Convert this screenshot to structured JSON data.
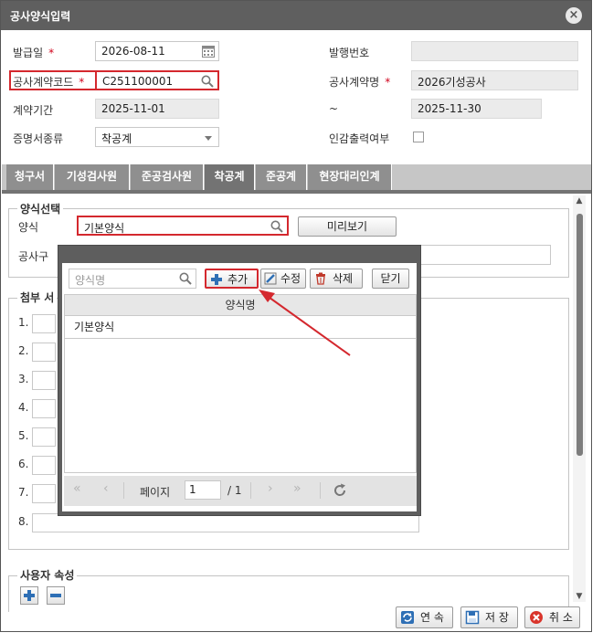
{
  "window": {
    "title": "공사양식입력"
  },
  "form": {
    "issue_date_label": "발급일",
    "issue_date_value": "2026-08-11",
    "issue_no_label": "발행번호",
    "contract_code_label": "공사계약코드",
    "contract_code_value": "C251100001",
    "contract_name_label": "공사계약명",
    "contract_name_value": "2026기성공사",
    "period_label": "계약기간",
    "period_start": "2025-11-01",
    "period_sep": "~",
    "period_end": "2025-11-30",
    "cert_type_label": "증명서종류",
    "cert_type_value": "착공계",
    "seal_print_label": "인감출력여부",
    "required_mark": "*"
  },
  "tabs": [
    {
      "label": "청구서"
    },
    {
      "label": "기성검사원"
    },
    {
      "label": "준공검사원"
    },
    {
      "label": "착공계",
      "active": true
    },
    {
      "label": "준공계"
    },
    {
      "label": "현장대리인계"
    }
  ],
  "template_section": {
    "legend": "양식선택",
    "template_label": "양식",
    "template_value": "기본양식",
    "preview_button": "미리보기",
    "config_label": "공사구"
  },
  "attach_section": {
    "legend": "첨부 서",
    "rows": [
      "1.",
      "2.",
      "3.",
      "4.",
      "5.",
      "6.",
      "7.",
      "8."
    ]
  },
  "user_section": {
    "legend": "사용자 속성"
  },
  "popup": {
    "search_placeholder": "양식명",
    "add_button": "추가",
    "edit_button": "수정",
    "delete_button": "삭제",
    "close_button": "닫기",
    "grid_header": "양식명",
    "rows": [
      {
        "name": "기본양식"
      }
    ],
    "pager": {
      "page_label": "페이지",
      "page_value": "1",
      "total": "/ 1"
    }
  },
  "footer": {
    "continue_button": "연 속",
    "save_button": "저 장",
    "cancel_button": "취 소"
  },
  "colors": {
    "annotation_red": "#d4282e",
    "title_bar": "#5f5f5f",
    "active_tab": "#737373"
  }
}
